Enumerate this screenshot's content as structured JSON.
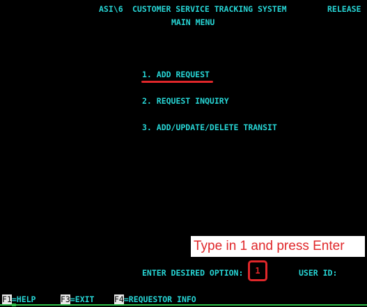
{
  "header": {
    "system_id": "ASI\\6",
    "title": "CUSTOMER SERVICE TRACKING SYSTEM",
    "release": "RELEASE",
    "menu_title": "MAIN MENU"
  },
  "menu": {
    "items": [
      {
        "label": "1. ADD REQUEST"
      },
      {
        "label": "2. REQUEST INQUIRY"
      },
      {
        "label": "3. ADD/UPDATE/DELETE TRANSIT"
      }
    ]
  },
  "annotation": {
    "text": "Type in 1 and press Enter"
  },
  "prompt": {
    "label": "ENTER DESIRED OPTION:",
    "value": "1",
    "user_label": "USER ID:"
  },
  "function_keys": [
    {
      "key": "F1",
      "action": "=HELP"
    },
    {
      "key": "F3",
      "action": "=EXIT"
    },
    {
      "key": "F4",
      "action": "=REQUESTOR INFO"
    }
  ],
  "colors": {
    "terminal_text": "#27d6d6",
    "highlight": "#e0272a",
    "background": "#000000",
    "status_bar": "#2fbf4a"
  }
}
